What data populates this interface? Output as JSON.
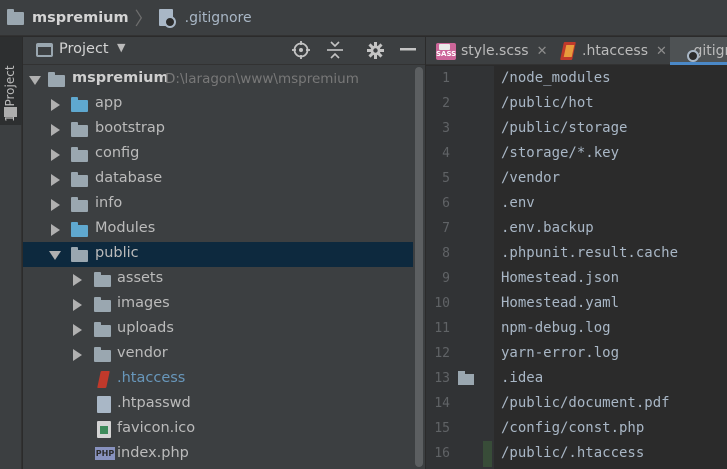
{
  "breadcrumb": {
    "root": "mspremium",
    "file": ".gitignore"
  },
  "toolstrip": {
    "project_tab": "1: Project"
  },
  "project_panel": {
    "title": "Project",
    "tree": [
      {
        "label": "mspremium",
        "path": "D:\\laragon\\www\\mspremium",
        "kind": "root",
        "expanded": true
      },
      {
        "label": "app",
        "kind": "folder-blue",
        "expanded": false
      },
      {
        "label": "bootstrap",
        "kind": "folder",
        "expanded": false
      },
      {
        "label": "config",
        "kind": "folder",
        "expanded": false
      },
      {
        "label": "database",
        "kind": "folder",
        "expanded": false
      },
      {
        "label": "info",
        "kind": "folder",
        "expanded": false
      },
      {
        "label": "Modules",
        "kind": "folder-blue",
        "expanded": false
      },
      {
        "label": "public",
        "kind": "folder",
        "expanded": true,
        "selected": true
      },
      {
        "label": "assets",
        "kind": "folder",
        "expanded": false
      },
      {
        "label": "images",
        "kind": "folder",
        "expanded": false
      },
      {
        "label": "uploads",
        "kind": "folder",
        "expanded": false
      },
      {
        "label": "vendor",
        "kind": "folder",
        "expanded": false
      },
      {
        "label": ".htaccess",
        "kind": "file-htaccess"
      },
      {
        "label": ".htpasswd",
        "kind": "file-text"
      },
      {
        "label": "favicon.ico",
        "kind": "file-ico"
      },
      {
        "label": "index.php",
        "kind": "file-php",
        "icon_text": "PHP"
      }
    ]
  },
  "tabs": [
    {
      "label": "style.scss",
      "icon": "sass-file-icon",
      "icon_text": "SASS",
      "close": "✕"
    },
    {
      "label": ".htaccess",
      "icon": "htaccess-file-icon",
      "close": "✕"
    },
    {
      "label": ".gitignore",
      "icon": "gitignore-file-icon",
      "active": true
    }
  ],
  "editor": {
    "lines": [
      {
        "num": "1",
        "text": "/node_modules"
      },
      {
        "num": "2",
        "text": "/public/hot"
      },
      {
        "num": "3",
        "text": "/public/storage"
      },
      {
        "num": "4",
        "text": "/storage/*.key"
      },
      {
        "num": "5",
        "text": "/vendor"
      },
      {
        "num": "6",
        "text": ".env"
      },
      {
        "num": "7",
        "text": ".env.backup"
      },
      {
        "num": "8",
        "text": ".phpunit.result.cache"
      },
      {
        "num": "9",
        "text": "Homestead.json"
      },
      {
        "num": "10",
        "text": "Homestead.yaml"
      },
      {
        "num": "11",
        "text": "npm-debug.log"
      },
      {
        "num": "12",
        "text": "yarn-error.log"
      },
      {
        "num": "13",
        "text": ".idea"
      },
      {
        "num": "14",
        "text": "/public/document.pdf"
      },
      {
        "num": "15",
        "text": "/config/const.php"
      },
      {
        "num": "16",
        "text": "/public/.htaccess"
      }
    ]
  },
  "colors": {
    "selection": "#0d293e",
    "accent": "#4a88c7",
    "vcs_added": "#384c38"
  }
}
